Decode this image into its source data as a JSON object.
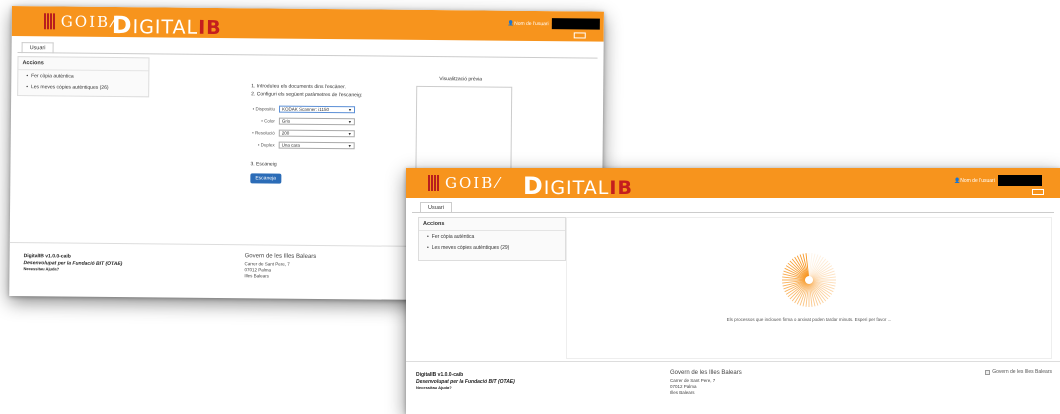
{
  "header": {
    "goib_text": "GOIB",
    "brand_d": "D",
    "brand_rest": "IGITAL",
    "brand_ib": "IB",
    "user_label": "Nom de l'usuari",
    "colors": {
      "bar": "#f7941d",
      "accent": "#c41e1e",
      "button": "#2b6cb7"
    }
  },
  "tab": {
    "label": "Usuari"
  },
  "accions": {
    "title": "Accions",
    "items_back": [
      "Fer còpia autèntica",
      "Les meves còpies autèntiques (26)"
    ],
    "items_front": [
      "Fer còpia autèntica",
      "Les meves còpies autèntiques (29)"
    ]
  },
  "scan": {
    "step1": "1. Introduïeu els documents dins l'escàner.",
    "step2": "2. Configuri els següent paràmetres de l'escaneig:",
    "options": [
      {
        "label": "Dispositiu",
        "value": "KODAK Scanner: i1150"
      },
      {
        "label": "Color",
        "value": "Gris"
      },
      {
        "label": "Resolució",
        "value": "200"
      },
      {
        "label": "Duplex",
        "value": "Una cara"
      }
    ],
    "step3": "3. Escaneig",
    "button": "Escaneja",
    "preview_label": "Visualització prèvia"
  },
  "busy": {
    "message": "Els processos que inclouen firma o arxivat poden tardar minuts. Esperi per favor ..."
  },
  "footer": {
    "version": "DigitalIB v1.0.0-caib",
    "developed": "Desenvolupat per la Fundació BIT (OTAE)",
    "help": "Necessitau Ajuda?",
    "org": "Govern de les Illes Balears",
    "address": [
      "Carrer de Sant Pere, 7",
      "07012 Palma",
      "Illes Balears"
    ],
    "logo_alt": "Govern de les Illes Balears"
  }
}
